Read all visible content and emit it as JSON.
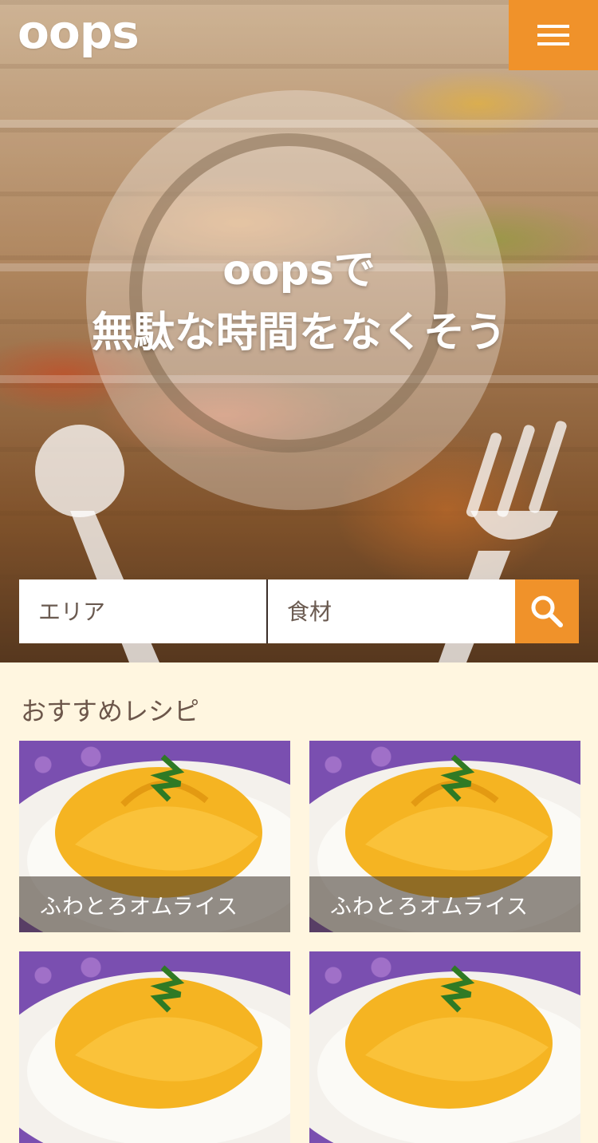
{
  "header": {
    "logo": "oops",
    "menu_icon": "hamburger-icon"
  },
  "hero": {
    "title_line1": "oopsで",
    "title_line2": "無駄な時間をなくそう"
  },
  "search": {
    "area_placeholder": "エリア",
    "ingredient_placeholder": "食材",
    "button_icon": "search-icon"
  },
  "recommended": {
    "title": "おすすめレシピ",
    "recipes": [
      {
        "name": "ふわとろオムライス"
      },
      {
        "name": "ふわとろオムライス"
      },
      {
        "name": ""
      },
      {
        "name": ""
      }
    ]
  },
  "colors": {
    "accent": "#f0922a",
    "page_background": "#fff6e0",
    "section_text": "#6c564a"
  }
}
